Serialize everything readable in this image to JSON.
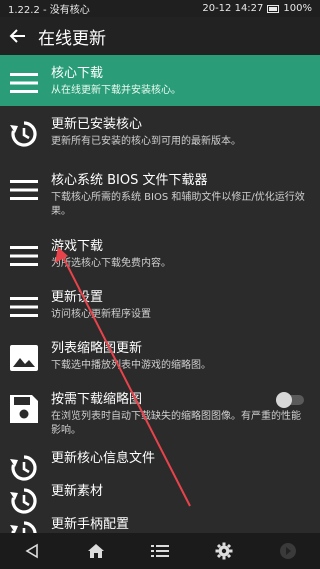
{
  "status_bar": {
    "left": "1.22.2 - 没有核心",
    "time": "20-12 14:27",
    "battery": "100%"
  },
  "app_bar": {
    "title": "在线更新",
    "back_icon": "arrow-left-icon"
  },
  "menu": {
    "items": [
      {
        "label": "核心下载",
        "desc": "从在线更新下载并安装核心。",
        "icon": "hamburger-icon",
        "active": true
      },
      {
        "label": "更新已安装核心",
        "desc": "更新所有已安装的核心到可用的最新版本。",
        "icon": "refresh-icon"
      },
      {
        "label": "核心系统 BIOS 文件下载器",
        "desc": "下载核心所需的系统 BIOS 和辅助文件以修正/优化运行效果。",
        "icon": "hamburger-icon"
      },
      {
        "label": "游戏下载",
        "desc": "为所选核心下载免费内容。",
        "icon": "hamburger-icon"
      },
      {
        "label": "更新设置",
        "desc": "访问核心更新程序设置",
        "icon": "hamburger-icon"
      },
      {
        "label": "列表缩略图更新",
        "desc": "下载选中播放列表中游戏的缩略图。",
        "icon": "image-icon"
      },
      {
        "label": "按需下载缩略图",
        "desc": "在浏览列表时自动下载缺失的缩略图图像。有严重的性能影响。",
        "icon": "floppy-icon",
        "toggle": "off"
      },
      {
        "label": "更新核心信息文件",
        "desc": "",
        "icon": "refresh-icon"
      },
      {
        "label": "更新素材",
        "desc": "",
        "icon": "refresh-icon"
      },
      {
        "label": "更新手柄配置",
        "desc": "",
        "icon": "refresh-icon"
      }
    ]
  },
  "nav_bar": {
    "buttons": [
      "back-triangle-icon",
      "home-icon",
      "list-icon",
      "settings-gear-icon",
      "circle-icon"
    ]
  },
  "colors": {
    "accent": "#2a9d78",
    "background": "#2b2b2b",
    "arrow": "#e8434a"
  }
}
